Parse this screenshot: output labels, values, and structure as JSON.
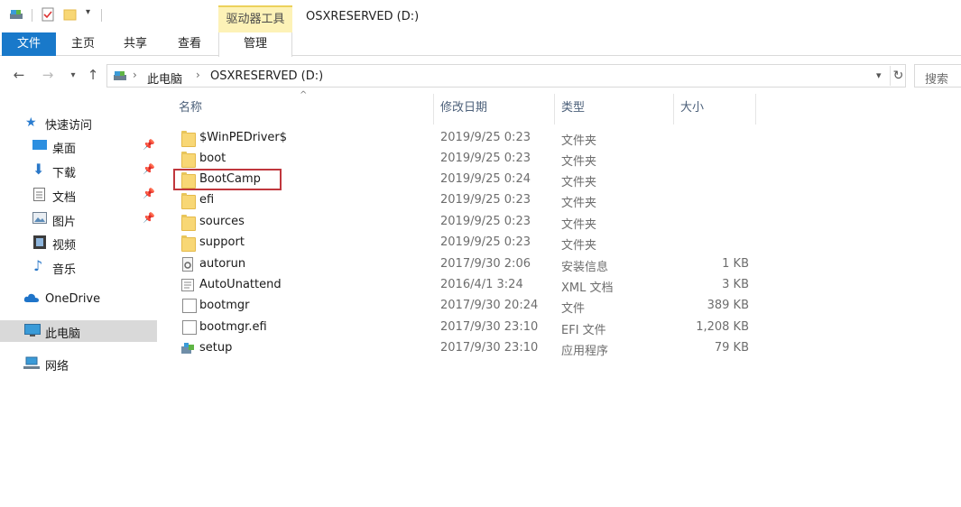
{
  "titlebar": {
    "context_tab": "驱动器工具",
    "window_title": "OSXRESERVED (D:)"
  },
  "ribbon": {
    "tabs": [
      {
        "label": "文件"
      },
      {
        "label": "主页"
      },
      {
        "label": "共享"
      },
      {
        "label": "查看"
      },
      {
        "label": "管理"
      }
    ]
  },
  "address": {
    "crumbs": [
      "此电脑",
      "OSXRESERVED (D:)"
    ],
    "search_placeholder": "搜索"
  },
  "sidebar": {
    "items": [
      {
        "label": "快速访问",
        "icon": "star-icon",
        "pinned": false
      },
      {
        "label": "桌面",
        "icon": "desktop-icon",
        "pinned": true
      },
      {
        "label": "下载",
        "icon": "download-icon",
        "pinned": true
      },
      {
        "label": "文档",
        "icon": "document-icon",
        "pinned": true
      },
      {
        "label": "图片",
        "icon": "pictures-icon",
        "pinned": true
      },
      {
        "label": "视频",
        "icon": "video-icon",
        "pinned": false
      },
      {
        "label": "音乐",
        "icon": "music-icon",
        "pinned": false
      },
      {
        "label": "OneDrive",
        "icon": "cloud-icon",
        "pinned": false
      },
      {
        "label": "此电脑",
        "icon": "computer-icon",
        "pinned": false,
        "selected": true
      },
      {
        "label": "网络",
        "icon": "network-icon",
        "pinned": false
      }
    ]
  },
  "columns": {
    "name": "名称",
    "date": "修改日期",
    "type": "类型",
    "size": "大小"
  },
  "files": [
    {
      "name": "$WinPEDriver$",
      "date": "2019/9/25 0:23",
      "type": "文件夹",
      "size": "",
      "icon": "folder-icon"
    },
    {
      "name": "boot",
      "date": "2019/9/25 0:23",
      "type": "文件夹",
      "size": "",
      "icon": "folder-icon"
    },
    {
      "name": "BootCamp",
      "date": "2019/9/25 0:24",
      "type": "文件夹",
      "size": "",
      "icon": "folder-icon"
    },
    {
      "name": "efi",
      "date": "2019/9/25 0:23",
      "type": "文件夹",
      "size": "",
      "icon": "folder-icon"
    },
    {
      "name": "sources",
      "date": "2019/9/25 0:23",
      "type": "文件夹",
      "size": "",
      "icon": "folder-icon"
    },
    {
      "name": "support",
      "date": "2019/9/25 0:23",
      "type": "文件夹",
      "size": "",
      "icon": "folder-icon"
    },
    {
      "name": "autorun",
      "date": "2017/9/30 2:06",
      "type": "安装信息",
      "size": "1 KB",
      "icon": "settings-file-icon"
    },
    {
      "name": "AutoUnattend",
      "date": "2016/4/1 3:24",
      "type": "XML 文档",
      "size": "3 KB",
      "icon": "xml-file-icon"
    },
    {
      "name": "bootmgr",
      "date": "2017/9/30 20:24",
      "type": "文件",
      "size": "389 KB",
      "icon": "file-icon"
    },
    {
      "name": "bootmgr.efi",
      "date": "2017/9/30 23:10",
      "type": "EFI 文件",
      "size": "1,208 KB",
      "icon": "file-icon"
    },
    {
      "name": "setup",
      "date": "2017/9/30 23:10",
      "type": "应用程序",
      "size": "79 KB",
      "icon": "setup-app-icon"
    }
  ],
  "colors": {
    "file_tab": "#1979ca",
    "context_tab": "#fdf2b7",
    "folder": "#f8d775",
    "highlight_box": "#c0373d",
    "selected_nav": "#d9d9d9"
  }
}
